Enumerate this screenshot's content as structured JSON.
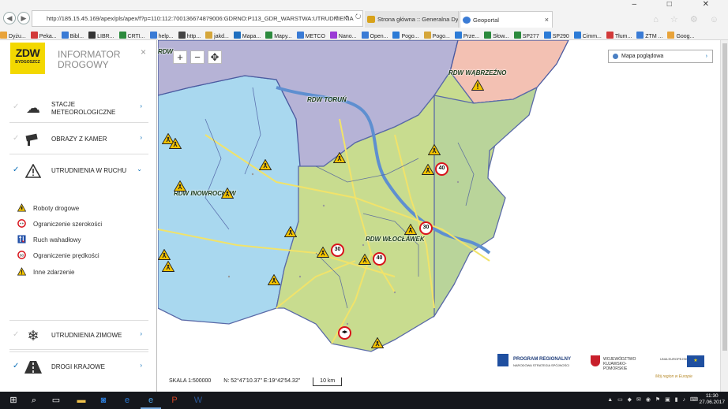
{
  "browser": {
    "url": "http://185.15.45.169/apex/pls/apex/f?p=110:112:7001366748790​06:GDRNO:P113_GDR_WARSTWA:UTRUDNIENIA",
    "tabs": [
      {
        "label": "Strona główna :: Generalna Dyr..."
      },
      {
        "label": "Geoportal"
      }
    ],
    "tab_close": "×",
    "window_controls": "– □ ✕",
    "favorites": [
      "Dyżu...",
      "Peka...",
      "Bibl...",
      "LIBR...",
      "CRTI...",
      "help...",
      "http...",
      "jakd...",
      "Mapa...",
      "Mapy...",
      "METCO",
      "Nano...",
      "Open...",
      "Pogo...",
      "Pogo...",
      "Prze...",
      "Słow...",
      "SP277",
      "SP290",
      "Cimm...",
      "Tłum...",
      "ZTM ...",
      "Goog..."
    ]
  },
  "sidebar": {
    "logo_text": "ZDW",
    "logo_sub": "BYDGOSZCZ",
    "title": "INFORMATOR DROGOWY",
    "close": "×",
    "menu": [
      {
        "label": "STACJE METEOROLOGICZNE",
        "checked": false,
        "icon": "cloud-sun-icon",
        "arrow": "›"
      },
      {
        "label": "OBRAZY Z KAMER",
        "checked": false,
        "icon": "camera-icon",
        "arrow": "›"
      },
      {
        "label": "UTRUDNIENIA W RUCHU",
        "checked": true,
        "icon": "warning-icon",
        "arrow": "⌄"
      },
      {
        "label": "UTRUDNIENIA ZIMOWE",
        "checked": false,
        "icon": "snowflake-icon",
        "arrow": "›"
      },
      {
        "label": "DROGI KRAJOWE",
        "checked": true,
        "icon": "road-icon",
        "arrow": "›"
      }
    ],
    "legend": [
      {
        "label": "Roboty drogowe",
        "icon": "roadworks-icon"
      },
      {
        "label": "Ograniczenie szerokości",
        "icon": "width-limit-icon"
      },
      {
        "label": "Ruch wahadłowy",
        "icon": "alternating-traffic-icon"
      },
      {
        "label": "Ograniczenie prędkości",
        "icon": "speed-limit-icon"
      },
      {
        "label": "Inne zdarzenie",
        "icon": "other-event-icon"
      }
    ]
  },
  "map": {
    "basemap_selector": "Mapa poglądowa",
    "controls": [
      "+",
      "−",
      "✥"
    ],
    "region_labels": [
      "RDW WĄBRZEŹNO",
      "RDW TORUŃ",
      "RDW INOWROCŁAW",
      "RDW WŁOCŁAWEK",
      "RDW"
    ],
    "speed_signs": [
      "40",
      "30",
      "30",
      "40"
    ],
    "scale": "SKALA 1:500000",
    "coords": "N: 52°47'10.37\"  E:19°42'54.32\"",
    "scalebar": "10 km",
    "partner_logos": [
      "PROGRAM REGIONALNY",
      "NARODOWA STRATEGIA SPÓJNOŚCI",
      "WOJEWÓDZTWO KUJAWSKO-POMORSKIE",
      "UNIA EUROPEJSKA",
      "Mój region w Europie"
    ]
  },
  "taskbar": {
    "time": "11:30",
    "date": "27.06.2017"
  },
  "colors": {
    "logo_yellow": "#f3d800",
    "accent_blue": "#0b6fb8",
    "region_blue": "#a9d8ef",
    "region_green": "#c8dc8f",
    "region_purple": "#b6b3d6",
    "region_pink": "#f3c1b3"
  }
}
